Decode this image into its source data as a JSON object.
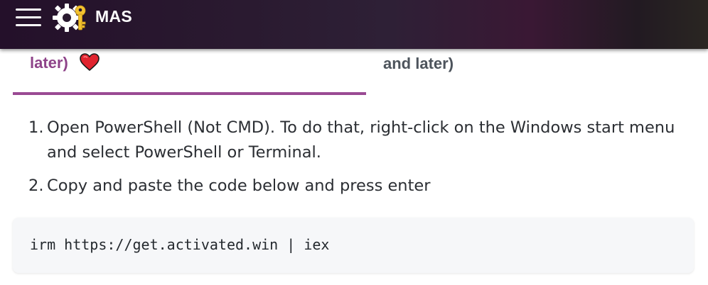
{
  "header": {
    "brand": "MAS",
    "menu_icon": "hamburger-menu-icon",
    "logo_icon": "gear-key-logo-icon",
    "gradient_colors": [
      "#24102a",
      "#2e2036",
      "#3a1834",
      "#2a2622"
    ]
  },
  "tabs": [
    {
      "label": "later)",
      "active": true,
      "icon": "heart-icon",
      "accent": "#8e4389"
    },
    {
      "label": "and later)",
      "active": false
    }
  ],
  "steps": [
    {
      "number": "1.",
      "text": "Open PowerShell (Not CMD). To do that, right-click on the Windows start menu and select PowerShell or Terminal."
    },
    {
      "number": "2.",
      "text": "Copy and paste the code below and press enter"
    }
  ],
  "code": {
    "text": "irm https://get.activated.win | iex"
  },
  "colors": {
    "accent": "#9a4a93",
    "text": "#2b2e33",
    "code_bg": "#f6f7f9"
  }
}
